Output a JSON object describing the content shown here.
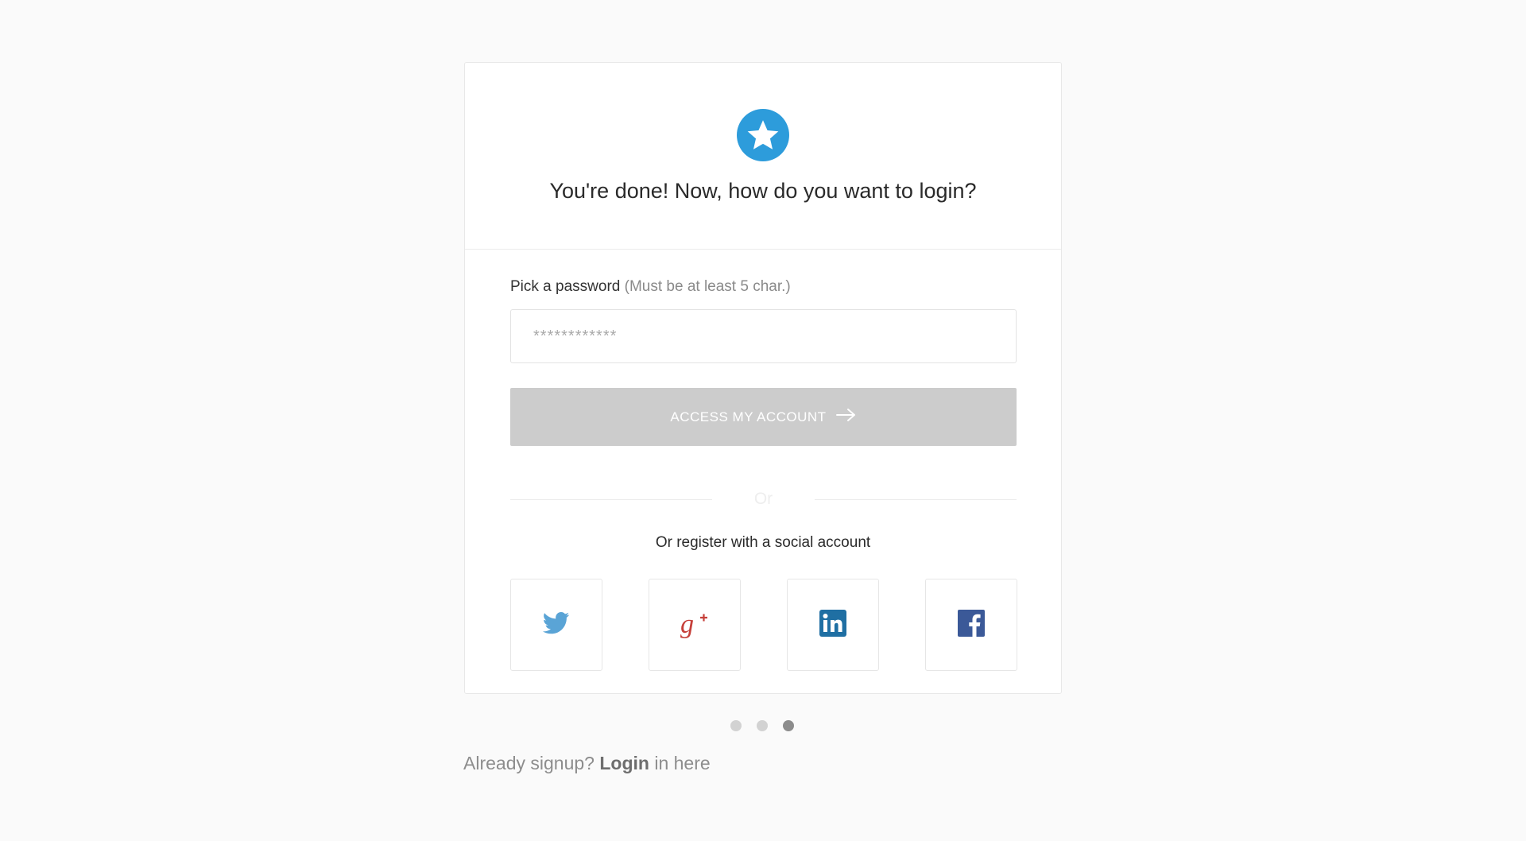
{
  "header": {
    "title": "You're done! Now, how do you want to login?",
    "badge_icon": "star-icon",
    "badge_color": "#2d9cdb"
  },
  "password": {
    "label": "Pick a password",
    "hint": "(Must be at least 5 char.)",
    "placeholder": "************"
  },
  "submit": {
    "label": "ACCESS MY ACCOUNT",
    "icon": "arrow-right-icon",
    "color": "#cccccc"
  },
  "divider": {
    "text": "Or"
  },
  "social": {
    "label": "Or register with a social account",
    "buttons": [
      {
        "name": "twitter",
        "icon": "twitter-icon",
        "color": "#5aa4d6"
      },
      {
        "name": "google-plus",
        "icon": "google-plus-icon",
        "color": "#c6403a"
      },
      {
        "name": "linkedin",
        "icon": "linkedin-icon",
        "color": "#1f6fa3"
      },
      {
        "name": "facebook",
        "icon": "facebook-icon",
        "color": "#3b5998"
      }
    ]
  },
  "pagination": {
    "total": 3,
    "active": 3
  },
  "footer": {
    "prefix": "Already signup?",
    "link": "Login",
    "suffix": "in here"
  }
}
